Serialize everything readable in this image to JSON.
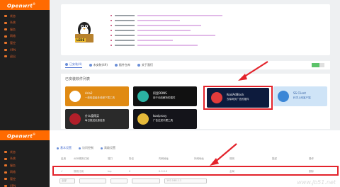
{
  "brand": {
    "name": "Openwrt"
  },
  "top_sidebar_items": [
    "状态",
    "系统",
    "服务",
    "网络",
    "管控",
    "VPN",
    "退出"
  ],
  "bottom_sidebar_items": [
    "状态",
    "系统",
    "服务",
    "网络",
    "管控",
    "VPN"
  ],
  "device_logo_text": "LEDE",
  "tabs": [
    {
      "label": "已安装(4)",
      "active": true
    },
    {
      "label": "未安装(49)",
      "active": false
    },
    {
      "label": "插件仓库",
      "active": false
    },
    {
      "label": "关于我们",
      "active": false
    }
  ],
  "progress_percent": 60,
  "panel_title": "已安装软件列表",
  "tiles": [
    {
      "title": "Aria2",
      "subtitle": "一款轻量级多线程下载工具",
      "bg": "#e08a12",
      "icon_bg": "#ffffff",
      "icon": "aria2-icon"
    },
    {
      "title": "阿里DDNS",
      "subtitle": "用于动态解析的插件",
      "bg": "#111111",
      "icon_bg": "#2bb3a3",
      "icon": "ddns-icon"
    },
    {
      "title": "KoolAdBlock",
      "subtitle": "去除网页广告的插件",
      "bg": "#0d1b3d",
      "icon_bg": "#e23b3b",
      "icon": "adblock-icon"
    },
    {
      "title": "SS Client",
      "subtitle": "科学上网客户端",
      "bg": "#cfe4f7",
      "icon_bg": "#3b86d6",
      "icon": "rocket-icon"
    },
    {
      "title": "什么值得买",
      "subtitle": "每日推送优惠信息",
      "bg": "#2a2a2a",
      "icon_bg": "#b11f2a",
      "icon": "smzdm-icon"
    },
    {
      "title": "koolproxy",
      "subtitle": "广告过滤代理工具",
      "bg": "#14141a",
      "icon_bg": "#e5b93a",
      "icon": "koolproxy-icon"
    }
  ],
  "bottom": {
    "tabs": [
      {
        "label": "基本设置",
        "active": true
      },
      {
        "label": "访问控制",
        "active": false
      },
      {
        "label": "高级设置",
        "active": false
      }
    ],
    "headers": [
      "启用",
      "ADB规则订阅",
      "端口",
      "协议",
      "内网地址",
      "外网地址",
      "规则",
      "描述",
      "操作"
    ],
    "row": [
      "√",
      "规则订阅",
      "tcp",
      "0",
      "0.0.0.0",
      "",
      "全局",
      "",
      "删除"
    ],
    "selects": [
      "全部",
      "",
      "",
      "",
      "192.168.1.1"
    ]
  },
  "watermark": "www.jb51.net",
  "accent_color": "#ff6a00",
  "highlight_color": "#e3232b"
}
